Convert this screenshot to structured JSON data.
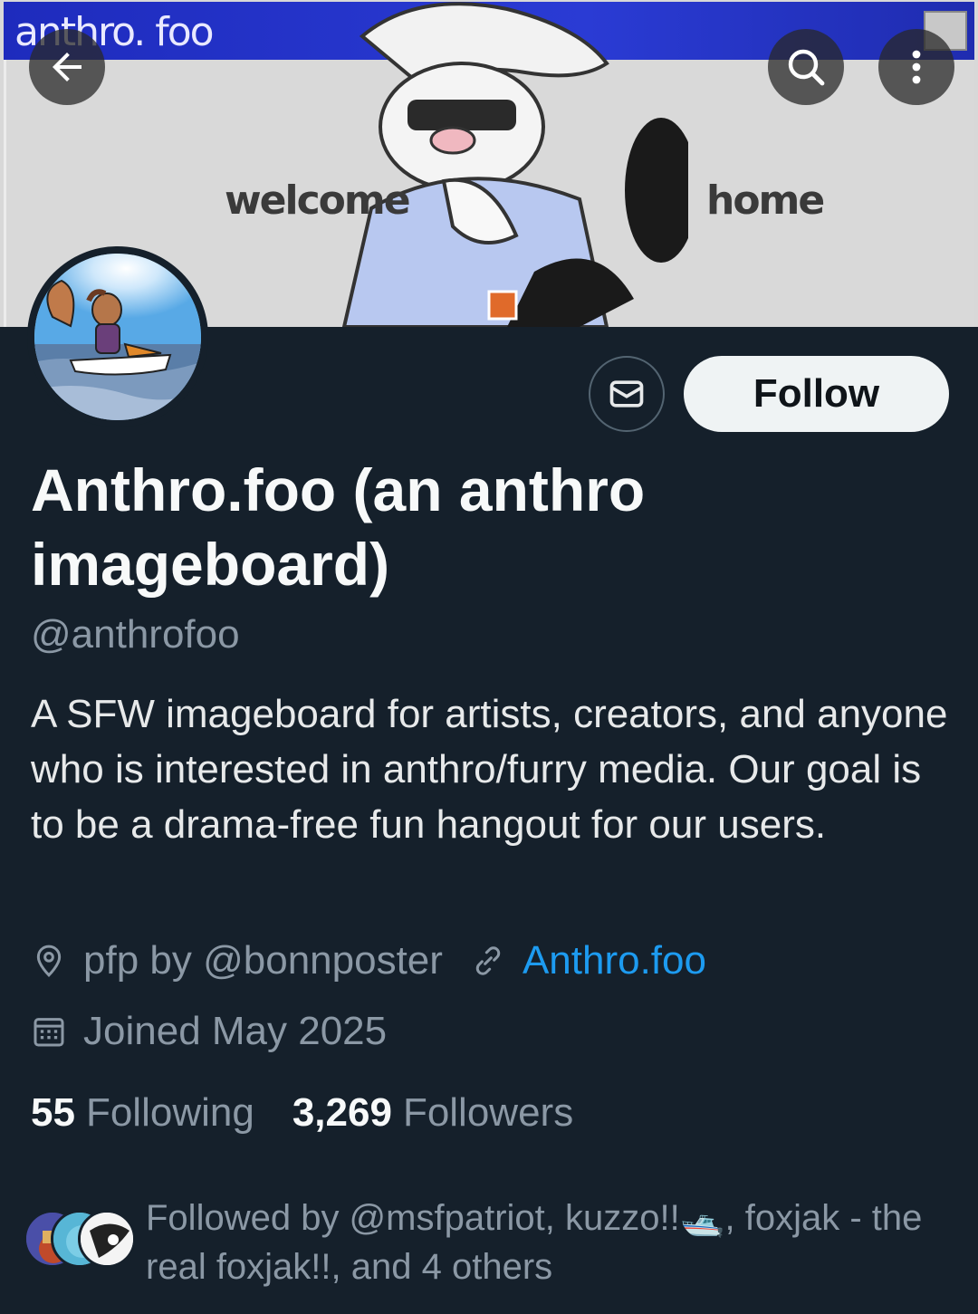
{
  "banner": {
    "window_title": "anthro. foo",
    "left_word": "welcome",
    "right_word": "home"
  },
  "nav": {
    "back_icon": "arrow-left-icon",
    "search_icon": "search-icon",
    "more_icon": "more-vertical-icon"
  },
  "profile": {
    "display_name": "Anthro.foo (an anthro imageboard)",
    "handle": "@anthrofoo",
    "bio": "A SFW imageboard for artists, creators, and anyone who is interested in anthro/furry media. Our goal is to be a drama-free fun hangout for our users.",
    "location": "pfp by @bonnposter",
    "website": "Anthro.foo",
    "joined": "Joined May 2025"
  },
  "actions": {
    "message_icon": "mail-icon",
    "follow_label": "Follow"
  },
  "stats": {
    "following_count": "55",
    "following_label": "Following",
    "followers_count": "3,269",
    "followers_label": "Followers"
  },
  "followed_by": {
    "text": "Followed by @msfpatriot, kuzzo!!🛥️, foxjak - the real foxjak!!, and 4 others"
  },
  "colors": {
    "background": "#15202b",
    "link": "#1d9bf0",
    "secondary_text": "#8b98a5",
    "follow_button_bg": "#eff3f4"
  }
}
